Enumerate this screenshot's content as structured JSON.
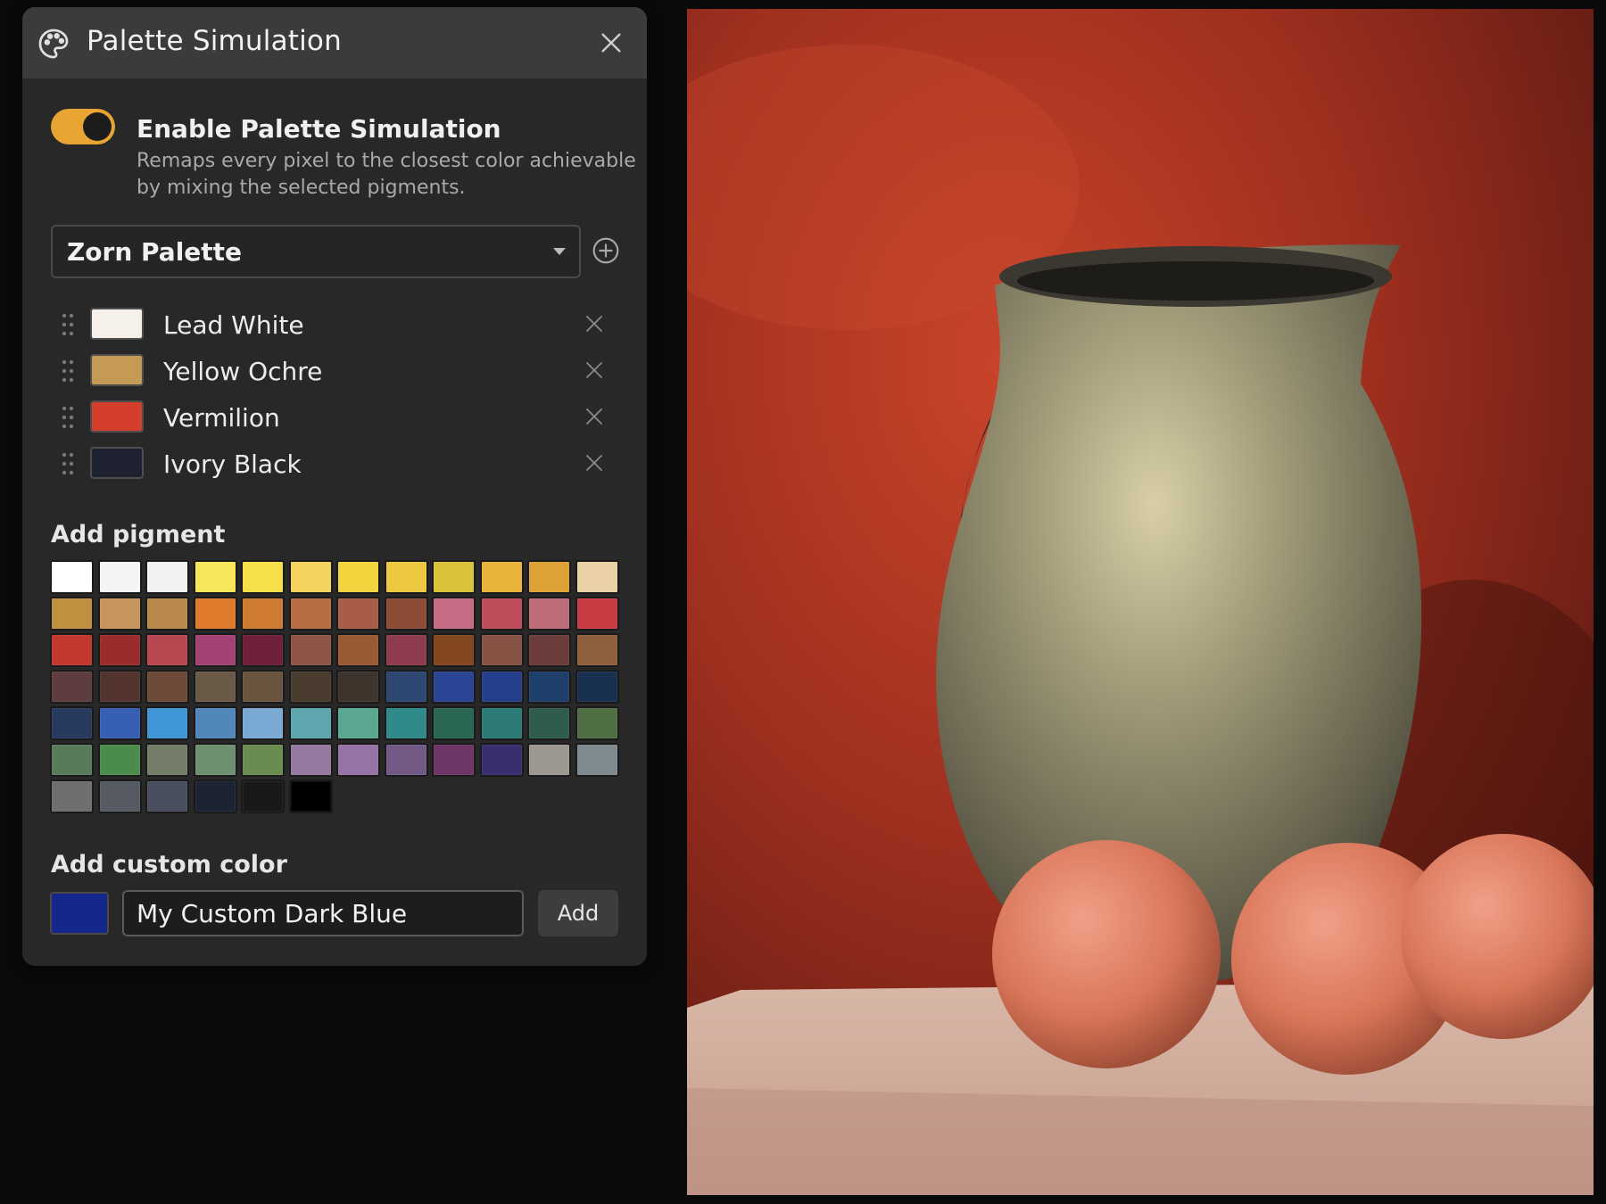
{
  "panel": {
    "title": "Palette Simulation",
    "icons": {
      "title_icon": "palette-icon",
      "close": "close-icon"
    }
  },
  "simulation": {
    "enabled": true,
    "title": "Enable Palette Simulation",
    "description": "Remaps every pixel to the closest color achievable by mixing the selected pigments."
  },
  "palette_select": {
    "value": "Zorn Palette",
    "icons": {
      "caret": "chevron-down-icon",
      "add": "plus-circle-icon"
    }
  },
  "pigments": [
    {
      "name": "Lead White",
      "color": "#f5f0ea"
    },
    {
      "name": "Yellow Ochre",
      "color": "#c49a54"
    },
    {
      "name": "Vermilion",
      "color": "#d43e2a"
    },
    {
      "name": "Ivory Black",
      "color": "#1e2230"
    }
  ],
  "add_pigment": {
    "label": "Add pigment",
    "swatches": [
      "#ffffff",
      "#f4f4f4",
      "#f1f1f0",
      "#f7e65a",
      "#f6df48",
      "#f4d35f",
      "#f2d43e",
      "#edc940",
      "#dcc238",
      "#eab43a",
      "#dda136",
      "#e9d1a5",
      "#be9140",
      "#c7945e",
      "#b8894a",
      "#e07a2b",
      "#ce7a30",
      "#b86c43",
      "#a95c48",
      "#8d4c35",
      "#c56c84",
      "#bf4c5a",
      "#be6c78",
      "#c93c42",
      "#c2382f",
      "#9a2c2b",
      "#b84752",
      "#a34374",
      "#6f1f3b",
      "#8e5446",
      "#9a5a36",
      "#8e3b4d",
      "#82471f",
      "#875244",
      "#6b3c3a",
      "#8e603e",
      "#5e3c40",
      "#53342f",
      "#6e4a3a",
      "#695b47",
      "#6b543f",
      "#4a3d30",
      "#3e342b",
      "#2f4773",
      "#2a4594",
      "#263f8c",
      "#1e3e6b",
      "#1a3050",
      "#283a5e",
      "#3760b5",
      "#4095d4",
      "#5287bb",
      "#7aa9d4",
      "#5ea6ad",
      "#5aa891",
      "#2f8a89",
      "#2a6654",
      "#2c7a76",
      "#2f5c4e",
      "#4f6f43",
      "#5a7a5c",
      "#4c8c4a",
      "#737d67",
      "#6f9070",
      "#6a8c50",
      "#957aa0",
      "#9674a6",
      "#735a86",
      "#6e3768",
      "#3a2f6e",
      "#9c9890",
      "#7f8990",
      "#6f6f6f",
      "#555a63",
      "#494f5e",
      "#1c2433",
      "#191919",
      "#000000"
    ]
  },
  "custom_color": {
    "label": "Add custom color",
    "color": "#13288a",
    "input_value": "My Custom Dark Blue",
    "add_label": "Add"
  },
  "icons": {
    "drag": "drag-handle-icon",
    "remove": "remove-icon"
  },
  "colors": {
    "accent": "#e8a531",
    "panel_bg": "#282828",
    "title_bg": "#3b3b3b"
  }
}
